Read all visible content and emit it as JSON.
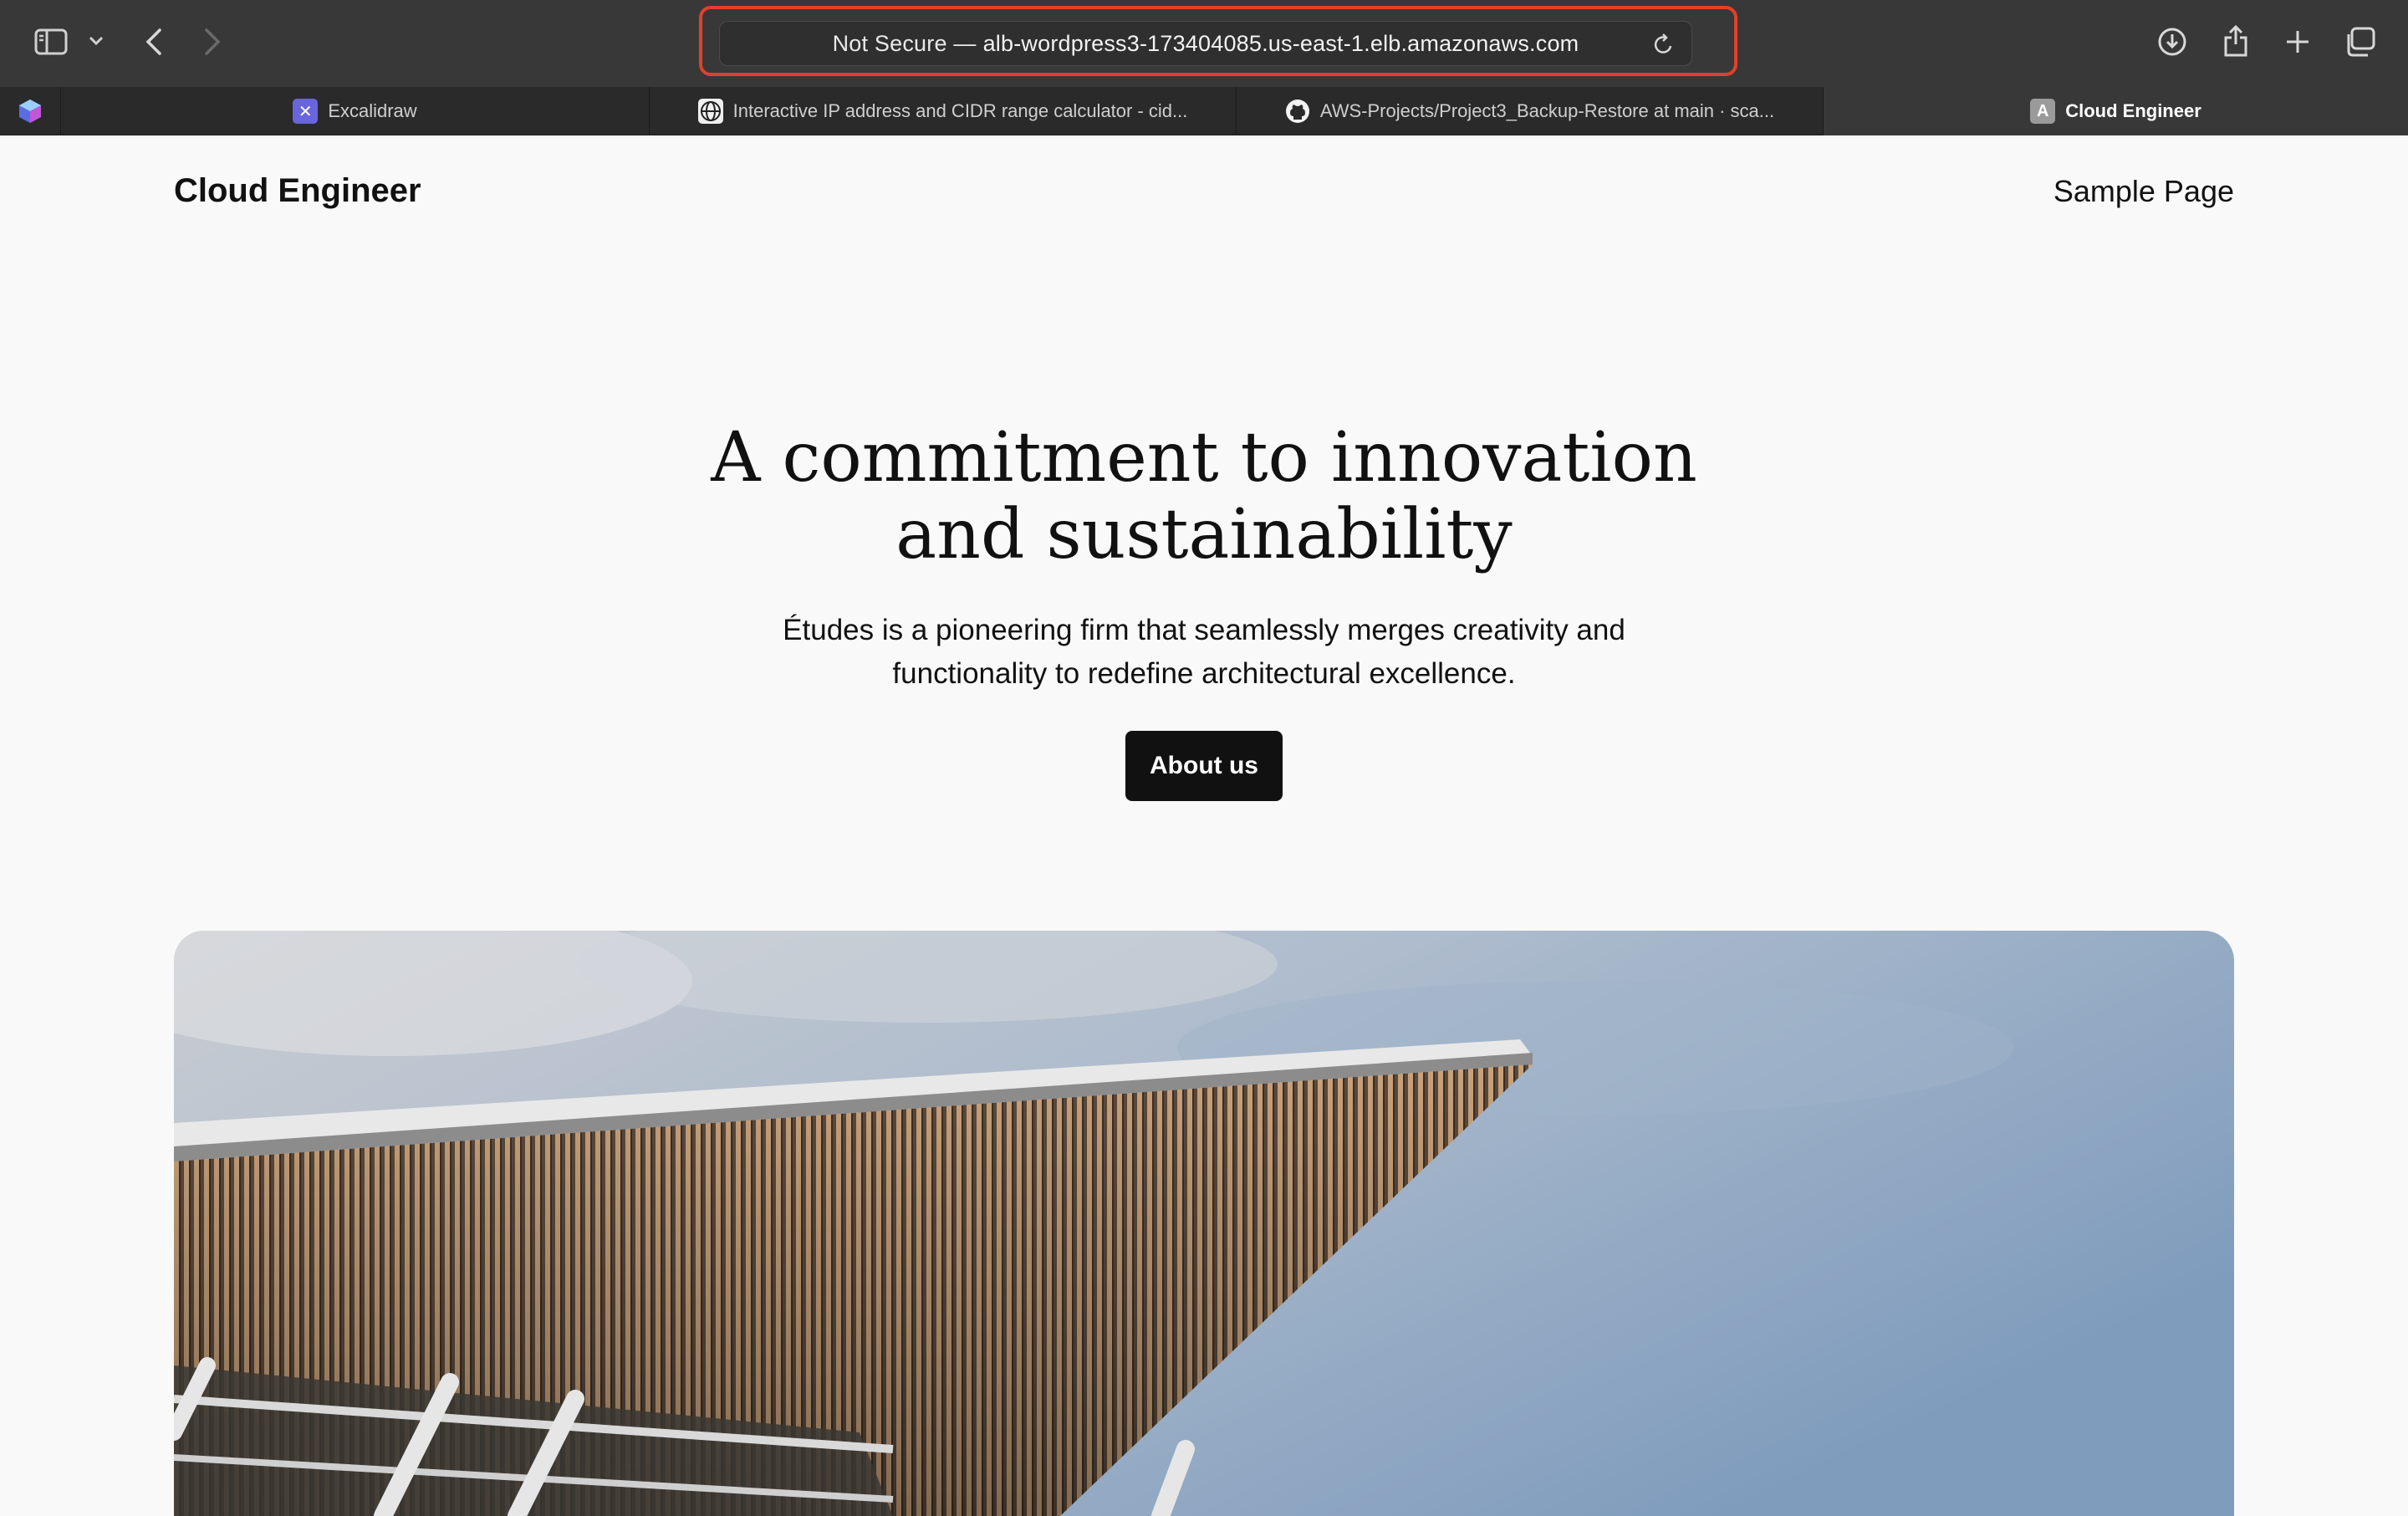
{
  "browser": {
    "address": {
      "security": "Not Secure —",
      "url": "alb-wordpress3-173404085.us-east-1.elb.amazonaws.com"
    },
    "tabs": [
      {
        "label": "Excalidraw",
        "icon": "excalidraw-icon"
      },
      {
        "label": "Interactive IP address and CIDR range calculator - cid...",
        "icon": "globe-icon"
      },
      {
        "label": "AWS-Projects/Project3_Backup-Restore at main · sca...",
        "icon": "github-icon"
      },
      {
        "label": "Cloud Engineer",
        "icon": "site-favicon",
        "favicon_letter": "A",
        "active": true
      }
    ],
    "icons": [
      "sidebar-icon",
      "chevron-down-icon",
      "back-icon",
      "forward-icon",
      "reload-icon",
      "download-icon",
      "share-icon",
      "new-tab-icon",
      "tab-overview-icon",
      "extension-icon"
    ],
    "highlight_color": "#e2402b"
  },
  "site": {
    "title": "Cloud Engineer",
    "nav": {
      "sample_page": "Sample Page"
    }
  },
  "hero": {
    "heading_line1": "A commitment to innovation",
    "heading_line2": "and sustainability",
    "subtitle_line1": "Études is a pioneering firm that seamlessly merges creativity and",
    "subtitle_line2": "functionality to redefine architectural excellence.",
    "cta_label": "About us",
    "image": "building-canopy-photo"
  }
}
